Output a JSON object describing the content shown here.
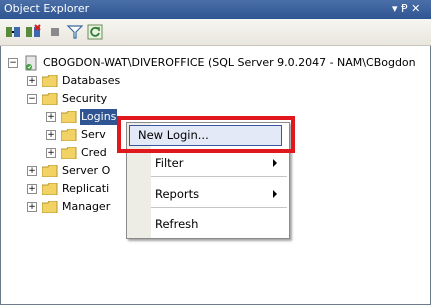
{
  "window": {
    "title": "Object Explorer",
    "pin_glyph": "▾ Ᵽ ✕"
  },
  "toolbar": {
    "icons": [
      "connect-icon",
      "disconnect-icon",
      "stop-icon",
      "filter-icon",
      "refresh-icon"
    ]
  },
  "tree": {
    "server": "CBOGDON-WAT\\DIVEROFFICE (SQL Server 9.0.2047 - NAM\\CBogdon",
    "databases": "Databases",
    "security": "Security",
    "logins": "Logins",
    "server_roles_partial": "Serv",
    "credentials_partial": "Cred",
    "server_objects_partial": "Server O",
    "replication_partial": "Replicati",
    "management_partial": "Manager"
  },
  "context_menu": {
    "items": [
      "New Login...",
      "Filter",
      "Reports",
      "Refresh"
    ]
  },
  "colors": {
    "highlight": "#e0171c",
    "folder": "#f2d165",
    "title": "#3a60a0"
  }
}
